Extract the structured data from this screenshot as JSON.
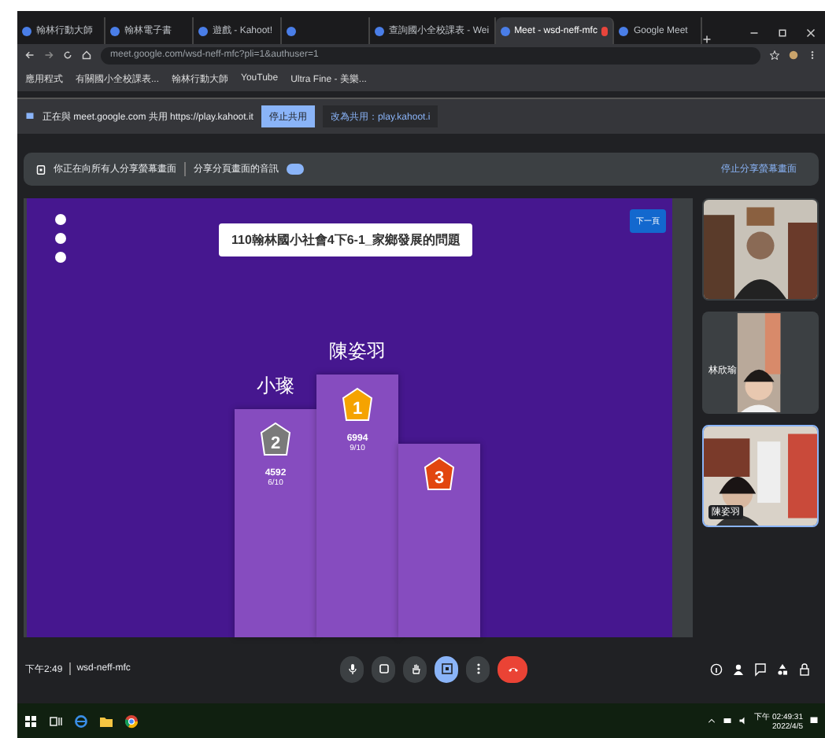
{
  "browser": {
    "tabs": [
      {
        "title": "翰林行動大師",
        "selected": false,
        "recording": false
      },
      {
        "title": "翰林電子書",
        "selected": false,
        "recording": false
      },
      {
        "title": "遊戲 - Kahoot!",
        "selected": false,
        "recording": false
      },
      {
        "selected": false,
        "recording": false
      },
      {
        "title": "查詢國小全校課表 - Wei",
        "selected": false,
        "recording": false
      },
      {
        "title": "Meet - wsd-neff-mfc",
        "selected": true,
        "recording": true
      },
      {
        "title": "Google Meet",
        "selected": false,
        "recording": false
      }
    ],
    "address": "meet.google.com/wsd-neff-mfc?pli=1&authuser=1",
    "bookmarks": [
      "應用程式",
      "有關國小全校課表...",
      "翰林行動大師",
      "YouTube",
      "Ultra Fine - 美樂..."
    ]
  },
  "share_bar": {
    "message": "正在與 meet.google.com 共用 https://play.kahoot.it",
    "buttons": [
      {
        "label": "停止共用",
        "selected": true
      },
      {
        "label": "改為共用：play.kahoot.i",
        "selected": false
      }
    ]
  },
  "meet": {
    "banner": {
      "message": "你正在向所有人分享螢幕畫面",
      "audio_label": "分享分頁畫面的音訊",
      "audio_on": true,
      "stop_label": "停止分享螢幕畫面"
    },
    "presentation": {
      "title": "110翰林國小社會4下6-1_家鄉發展的問題",
      "next_button": "下一頁",
      "podium": [
        {
          "rank": "2",
          "name": "小璨",
          "score": "4592",
          "correct": "6/10",
          "color": "#7a7a7a"
        },
        {
          "rank": "1",
          "name": "陳姿羽",
          "score": "6994",
          "correct": "9/10",
          "color": "#f5a300"
        },
        {
          "rank": "3",
          "color": "#e2460f"
        }
      ]
    },
    "participants": [
      {
        "selected": false
      },
      {
        "name": "林欣瑜",
        "selected": false
      },
      {
        "name": "陳姿羽",
        "selected": true
      }
    ],
    "time": "下午2:49",
    "meeting_code": "wsd-neff-mfc",
    "controls": [
      {
        "kind": "mic",
        "on": false
      },
      {
        "kind": "captions",
        "on": false
      },
      {
        "kind": "hand",
        "on": false
      },
      {
        "kind": "present",
        "on": true
      },
      {
        "kind": "more",
        "on": false
      },
      {
        "kind": "leave",
        "on": false
      }
    ]
  },
  "taskbar": {
    "time": "下午 02:49:31",
    "date": "2022/4/5"
  }
}
